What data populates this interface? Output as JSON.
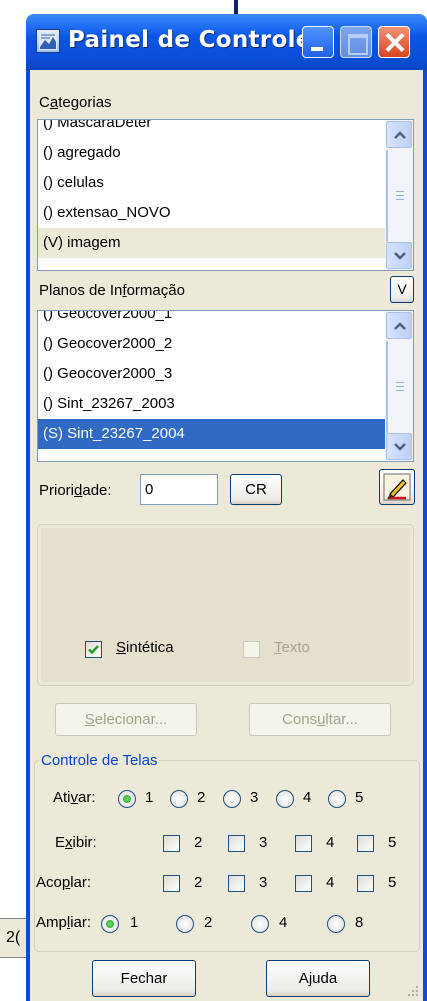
{
  "window": {
    "title": "Painel de Controle",
    "title_color": "#0a56e6",
    "background": "#ece9d8"
  },
  "categorias": {
    "label_pre": "C",
    "label_ul": "a",
    "label_post": "tegorias",
    "items": [
      {
        "text": "() MascaraDeter",
        "state": "normal"
      },
      {
        "text": "() agregado",
        "state": "normal"
      },
      {
        "text": "() celulas",
        "state": "normal"
      },
      {
        "text": "() extensao_NOVO",
        "state": "normal"
      },
      {
        "text": "(V) imagem",
        "state": "gray"
      }
    ]
  },
  "planos": {
    "label_pre": "Planos de In",
    "label_ul": "f",
    "label_post": "ormação",
    "visibility_button": "V",
    "items": [
      {
        "text": "() Geocover2000_1",
        "state": "normal"
      },
      {
        "text": "() Geocover2000_2",
        "state": "normal"
      },
      {
        "text": "() Geocover2000_3",
        "state": "normal"
      },
      {
        "text": "() Sint_23267_2003",
        "state": "normal"
      },
      {
        "text": "(S) Sint_23267_2004",
        "state": "selected"
      }
    ],
    "selection_color": "#316ac5"
  },
  "prioridade": {
    "label_pre": "Priori",
    "label_ul": "d",
    "label_post": "ade:",
    "value": "0",
    "cr_button": "CR",
    "edit_icon": "pencil-edit-icon"
  },
  "representacao": {
    "sintetica": {
      "label_ul": "S",
      "label_post": "intética",
      "checked": true
    },
    "texto": {
      "label_ul": "T",
      "label_post": "exto",
      "checked": false,
      "enabled": false
    }
  },
  "actions": {
    "selecionar_ul": "S",
    "selecionar_post": "elecionar...",
    "consultar_pre": "Cons",
    "consultar_ul": "u",
    "consultar_post": "ltar..."
  },
  "controle_telas": {
    "title": "Controle de Telas",
    "title_color": "#0046d5",
    "ativar": {
      "label_pre": "Ati",
      "label_ul": "v",
      "label_post": "ar:",
      "options": [
        "1",
        "2",
        "3",
        "4",
        "5"
      ],
      "selected": "1"
    },
    "exibir": {
      "label_pre": "E",
      "label_ul": "x",
      "label_post": "ibir:",
      "options": [
        "2",
        "3",
        "4",
        "5"
      ]
    },
    "acoplar": {
      "label_pre": "Aco",
      "label_ul": "p",
      "label_post": "lar:",
      "options": [
        "2",
        "3",
        "4",
        "5"
      ]
    },
    "ampliar": {
      "label_pre": "Amp",
      "label_ul": "l",
      "label_post": "iar:",
      "options": [
        "1",
        "2",
        "4",
        "8"
      ],
      "selected": "1"
    }
  },
  "footer": {
    "fechar": "Fechar",
    "ajuda_pre": "A",
    "ajuda_ul": "j",
    "ajuda_post": "uda"
  },
  "background_peek_text": "2("
}
